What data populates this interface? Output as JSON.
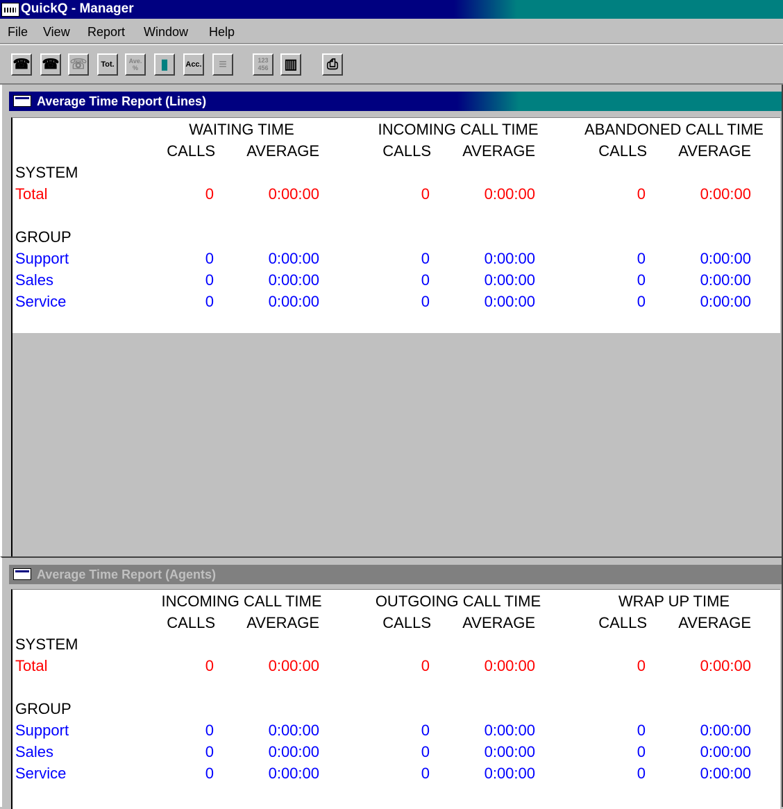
{
  "app": {
    "title": "QuickQ - Manager"
  },
  "menu": [
    "File",
    "View",
    "Report",
    "Window",
    "Help"
  ],
  "toolbar": {
    "buttons": [
      {
        "name": "phone-icon",
        "glyph": "☎",
        "enabled": true
      },
      {
        "name": "phone-agents-icon",
        "glyph": "☎",
        "enabled": true
      },
      {
        "name": "phone-stats-icon",
        "glyph": "☏",
        "enabled": false
      },
      {
        "name": "totals-button",
        "text": "Tot.",
        "enabled": true
      },
      {
        "name": "average-percent-button",
        "text": "Ave. %",
        "enabled": false
      },
      {
        "name": "battery-icon",
        "glyph": "▮",
        "enabled": true
      },
      {
        "name": "accumulate-button",
        "text": "Acc.",
        "enabled": true
      },
      {
        "name": "traffic-light-icon",
        "glyph": "≡",
        "enabled": false
      },
      {
        "name": "numeric-view-button",
        "text": "123 456",
        "enabled": false
      },
      {
        "name": "bar-chart-icon",
        "glyph": "▥",
        "enabled": true
      },
      {
        "name": "printer-icon",
        "glyph": "⎙",
        "enabled": true
      }
    ]
  },
  "lines_report": {
    "title": "Average Time Report (Lines)",
    "groups": [
      "WAITING TIME",
      "INCOMING CALL TIME",
      "ABANDONED CALL TIME"
    ],
    "col_calls": "CALLS",
    "col_average": "AVERAGE",
    "system_label": "SYSTEM",
    "group_label": "GROUP",
    "total": {
      "label": "Total",
      "values": [
        "0",
        "0:00:00",
        "0",
        "0:00:00",
        "0",
        "0:00:00"
      ]
    },
    "rows": [
      {
        "label": "Support",
        "values": [
          "0",
          "0:00:00",
          "0",
          "0:00:00",
          "0",
          "0:00:00"
        ]
      },
      {
        "label": "Sales",
        "values": [
          "0",
          "0:00:00",
          "0",
          "0:00:00",
          "0",
          "0:00:00"
        ]
      },
      {
        "label": "Service",
        "values": [
          "0",
          "0:00:00",
          "0",
          "0:00:00",
          "0",
          "0:00:00"
        ]
      }
    ]
  },
  "agents_report": {
    "title": "Average Time Report (Agents)",
    "groups": [
      "INCOMING CALL TIME",
      "OUTGOING CALL TIME",
      "WRAP UP TIME"
    ],
    "col_calls": "CALLS",
    "col_average": "AVERAGE",
    "system_label": "SYSTEM",
    "group_label": "GROUP",
    "total": {
      "label": "Total",
      "values": [
        "0",
        "0:00:00",
        "0",
        "0:00:00",
        "0",
        "0:00:00"
      ]
    },
    "rows": [
      {
        "label": "Support",
        "values": [
          "0",
          "0:00:00",
          "0",
          "0:00:00",
          "0",
          "0:00:00"
        ]
      },
      {
        "label": "Sales",
        "values": [
          "0",
          "0:00:00",
          "0",
          "0:00:00",
          "0",
          "0:00:00"
        ]
      },
      {
        "label": "Service",
        "values": [
          "0",
          "0:00:00",
          "0",
          "0:00:00",
          "0",
          "0:00:00"
        ]
      }
    ]
  }
}
